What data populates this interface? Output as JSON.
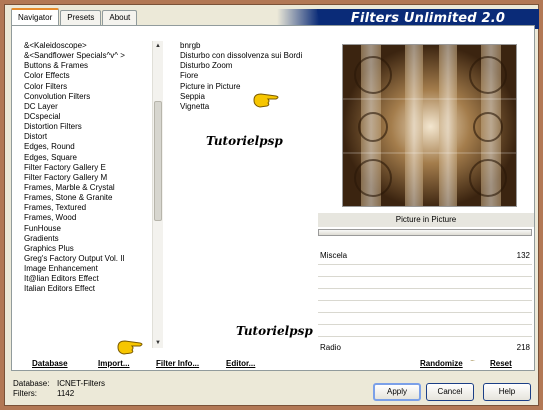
{
  "tabs": [
    {
      "label": "Navigator",
      "active": true
    },
    {
      "label": "Presets",
      "active": false
    },
    {
      "label": "About",
      "active": false
    }
  ],
  "banner_title": "Filters Unlimited 2.0",
  "categories": [
    "&<Kaleidoscope>",
    "&<Sandflower Specials^v^ >",
    "Buttons & Frames",
    "Color Effects",
    "Color Filters",
    "Convolution Filters",
    "DC Layer",
    "DCspecial",
    "Distortion Filters",
    "Distort",
    "Edges, Round",
    "Edges, Square",
    "Filter Factory Gallery E",
    "Filter Factory Gallery M",
    "Frames, Marble & Crystal",
    "Frames, Stone & Granite",
    "Frames, Textured",
    "Frames, Wood",
    "FunHouse",
    "Gradients",
    "Graphics Plus",
    "Greg's Factory Output Vol. II",
    "Image Enhancement",
    "It@lian Editors Effect",
    "Italian Editors Effect"
  ],
  "filters": [
    "bnrgb",
    "Disturbo con dissolvenza sui Bordi",
    "Disturbo Zoom",
    "Fiore",
    "Picture in Picture",
    "Seppia",
    "Vignetta"
  ],
  "watermark_text": "Tutorielpsp",
  "filter_caption": "Picture in Picture",
  "params": [
    {
      "label": "Miscela",
      "value": "132"
    },
    {
      "label": "Radio",
      "value": "218"
    }
  ],
  "links": {
    "database": "Database",
    "import": "Import...",
    "filter_info": "Filter Info...",
    "editor": "Editor...",
    "randomize": "Randomize",
    "reset": "Reset"
  },
  "status": {
    "database_label": "Database:",
    "database_value": "ICNET-Filters",
    "filters_label": "Filters:",
    "filters_value": "1142"
  },
  "buttons": {
    "apply": "Apply",
    "cancel": "Cancel",
    "help": "Help"
  },
  "colors": {
    "outer_border": "#b27855",
    "banner": "#0a2b78"
  },
  "icons": [
    "pointing-hand-icon",
    "scroll-up-arrow-icon",
    "scroll-down-arrow-icon"
  ]
}
